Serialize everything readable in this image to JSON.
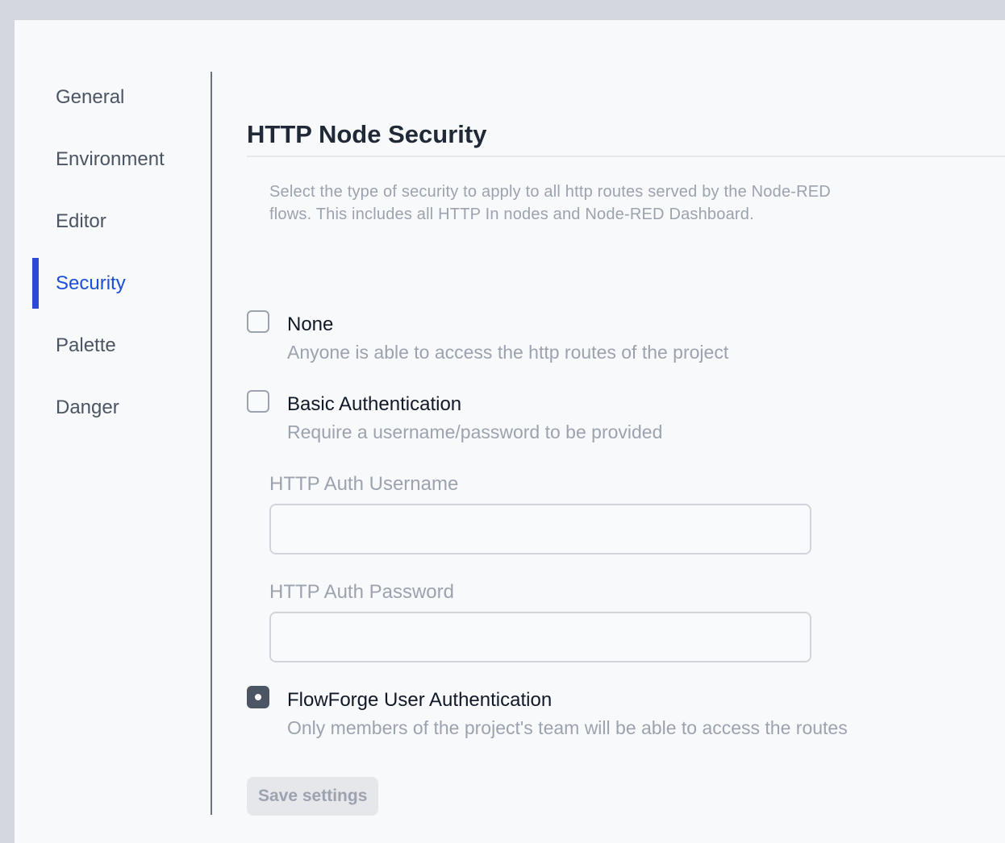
{
  "sidebar": {
    "items": [
      {
        "label": "General"
      },
      {
        "label": "Environment"
      },
      {
        "label": "Editor"
      },
      {
        "label": "Security",
        "active": true
      },
      {
        "label": "Palette"
      },
      {
        "label": "Danger"
      }
    ]
  },
  "main": {
    "title": "HTTP Node Security",
    "description": "Select the type of security to apply to all http routes served by the Node-RED flows. This includes all HTTP In nodes and Node-RED Dashboard.",
    "options": [
      {
        "label": "None",
        "help": "Anyone is able to access the http routes of the project",
        "checked": false
      },
      {
        "label": "Basic Authentication",
        "help": "Require a username/password to be provided",
        "checked": false
      },
      {
        "label": "FlowForge User Authentication",
        "help": "Only members of the project's team will be able to access the routes",
        "checked": true
      }
    ],
    "username_label": "HTTP Auth Username",
    "username_value": "",
    "password_label": "HTTP Auth Password",
    "password_value": "",
    "save_label": "Save settings"
  },
  "colors": {
    "accent": "#2b4bd6",
    "active_text": "#1d4ed8",
    "checked_radio": "#4b5563"
  }
}
